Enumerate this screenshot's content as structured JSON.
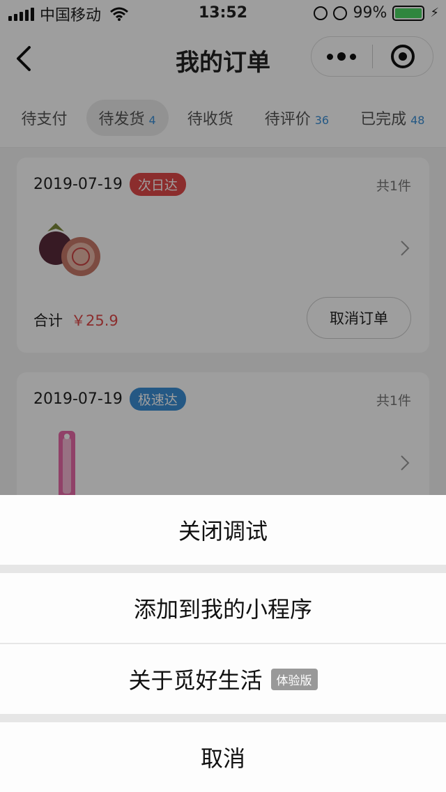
{
  "status_bar": {
    "carrier": "中国移动",
    "time": "13:52",
    "battery_percent": "99%",
    "battery_level": 0.99
  },
  "nav": {
    "title": "我的订单",
    "back_icon": "chevron-left-icon",
    "more_icon": "more-dots-icon",
    "close_icon": "target-icon"
  },
  "tabs": [
    {
      "label": "待支付",
      "count": ""
    },
    {
      "label": "待发货",
      "count": "4"
    },
    {
      "label": "待收货",
      "count": ""
    },
    {
      "label": "待评价",
      "count": "36"
    },
    {
      "label": "已完成",
      "count": "48"
    }
  ],
  "active_tab": "待发货",
  "orders": [
    {
      "date": "2019-07-19",
      "tag": "次日达",
      "tag_color": "#e04a4a",
      "quantity": "共1件",
      "total_label": "合计",
      "price": "￥25.9",
      "action": "取消订单",
      "product_icon": "mangosteen-icon"
    },
    {
      "date": "2019-07-19",
      "tag": "极速达",
      "tag_color": "#3a8fd6",
      "quantity": "共1件",
      "product_icon": "toothbrush-icon"
    }
  ],
  "action_sheet": {
    "items": [
      "关闭调试",
      "添加到我的小程序",
      "关于觅好生活"
    ],
    "badge": "体验版",
    "cancel": "取消"
  },
  "colors": {
    "accent_blue": "#3a8fd6",
    "accent_red": "#e04a4a",
    "battery_green": "#4cd964"
  }
}
